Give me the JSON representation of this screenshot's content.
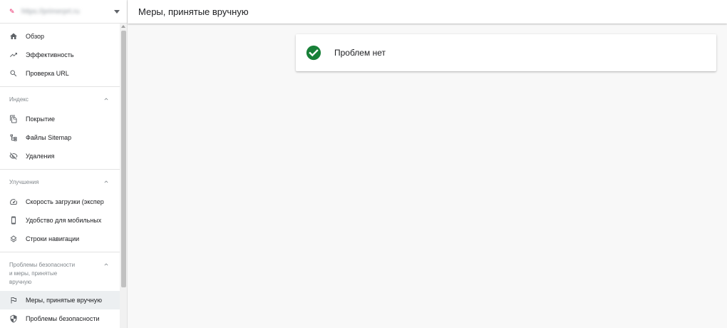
{
  "property": {
    "name": "https://primerprt.ru"
  },
  "sidebar": {
    "top_items": [
      {
        "label": "Обзор",
        "icon": "home-icon"
      },
      {
        "label": "Эффективность",
        "icon": "trending-up-icon"
      },
      {
        "label": "Проверка URL",
        "icon": "search-icon"
      }
    ],
    "sections": [
      {
        "title": "Индекс",
        "items": [
          {
            "label": "Покрытие",
            "icon": "copy-icon"
          },
          {
            "label": "Файлы Sitemap",
            "icon": "sitemap-icon"
          },
          {
            "label": "Удаления",
            "icon": "visibility-off-icon"
          }
        ]
      },
      {
        "title": "Улучшения",
        "items": [
          {
            "label": "Скорость загрузки (экспер",
            "icon": "speed-icon"
          },
          {
            "label": "Удобство для мобильных",
            "icon": "phone-icon"
          },
          {
            "label": "Строки навигации",
            "icon": "layers-icon"
          }
        ]
      },
      {
        "title_lines": [
          "Проблемы безопасности",
          "и меры, принятые",
          "вручную"
        ],
        "items": [
          {
            "label": "Меры, принятые вручную",
            "icon": "flag-icon",
            "active": true
          },
          {
            "label": "Проблемы безопасности",
            "icon": "shield-icon"
          }
        ]
      }
    ]
  },
  "header": {
    "title": "Меры, принятые вручную"
  },
  "card": {
    "message": "Проблем нет",
    "status_color": "#188038"
  }
}
